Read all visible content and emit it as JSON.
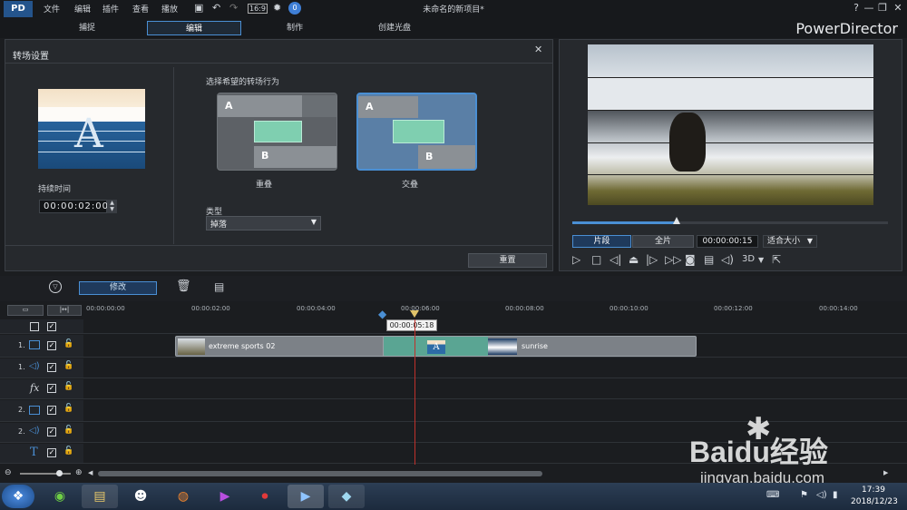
{
  "titlebar": {
    "menus": [
      "文件",
      "编辑",
      "插件",
      "查看",
      "播放"
    ],
    "title": "未命名的新项目*",
    "help": "?",
    "minimize": "—",
    "restore": "❐",
    "close": "✕"
  },
  "modes": {
    "capture": "捕捉",
    "edit": "编辑",
    "produce": "制作",
    "disc": "创建光盘",
    "brand": "PowerDirector"
  },
  "transition": {
    "title": "转场设置",
    "duration_label": "持续时间",
    "duration_value": "00:00:02:00",
    "behavior_label": "选择希望的转场行为",
    "option_overlap": "重叠",
    "option_cross": "交叠",
    "type_label": "类型",
    "type_value": "掉落",
    "reset_label": "重置",
    "letter_a": "A",
    "letter_b": "B",
    "thumb_letter": "A",
    "close": "✕"
  },
  "preview": {
    "clip_btn": "片段",
    "movie_btn": "全片",
    "timecode": "00:00:00:15",
    "fit": "适合大小",
    "mode3d": "3D",
    "scrub_progress": 0.33
  },
  "timeline": {
    "modify_label": "修改",
    "tooltip_time": "00:00:05:18",
    "ruler": [
      "00:00:00:00",
      "00:00:02:00",
      "00:00:04:00",
      "00:00:06:00",
      "00:00:08:00",
      "00:00:10:00",
      "00:00:12:00",
      "00:00:14:00"
    ],
    "clip1": "extreme sports 02",
    "clip2": "sunrise",
    "tracks": [
      "1.",
      "1.",
      "",
      "2.",
      "2.",
      ""
    ]
  },
  "taskbar": {
    "time": "17:39",
    "date": "2018/12/23"
  },
  "watermark": {
    "brand": "Baidu经验",
    "url": "jingyan.baidu.com"
  },
  "colors": {
    "accent": "#4a8fd4",
    "clip_bar": "#7c8187",
    "transition_green": "#7fcfb0"
  }
}
